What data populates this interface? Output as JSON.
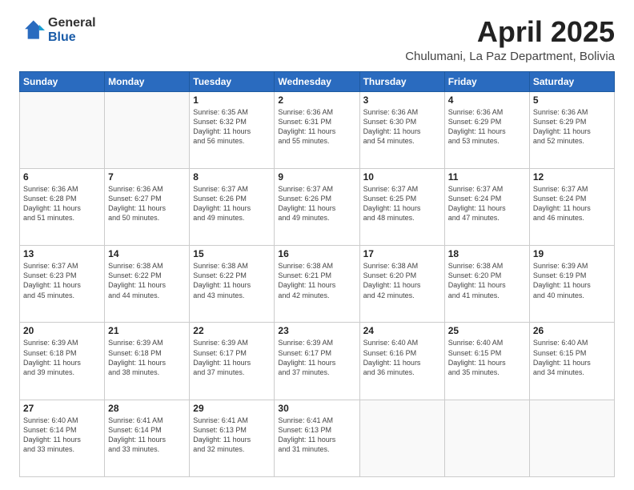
{
  "logo": {
    "general": "General",
    "blue": "Blue"
  },
  "title": "April 2025",
  "location": "Chulumani, La Paz Department, Bolivia",
  "days_header": [
    "Sunday",
    "Monday",
    "Tuesday",
    "Wednesday",
    "Thursday",
    "Friday",
    "Saturday"
  ],
  "weeks": [
    [
      {
        "day": "",
        "info": ""
      },
      {
        "day": "",
        "info": ""
      },
      {
        "day": "1",
        "info": "Sunrise: 6:35 AM\nSunset: 6:32 PM\nDaylight: 11 hours\nand 56 minutes."
      },
      {
        "day": "2",
        "info": "Sunrise: 6:36 AM\nSunset: 6:31 PM\nDaylight: 11 hours\nand 55 minutes."
      },
      {
        "day": "3",
        "info": "Sunrise: 6:36 AM\nSunset: 6:30 PM\nDaylight: 11 hours\nand 54 minutes."
      },
      {
        "day": "4",
        "info": "Sunrise: 6:36 AM\nSunset: 6:29 PM\nDaylight: 11 hours\nand 53 minutes."
      },
      {
        "day": "5",
        "info": "Sunrise: 6:36 AM\nSunset: 6:29 PM\nDaylight: 11 hours\nand 52 minutes."
      }
    ],
    [
      {
        "day": "6",
        "info": "Sunrise: 6:36 AM\nSunset: 6:28 PM\nDaylight: 11 hours\nand 51 minutes."
      },
      {
        "day": "7",
        "info": "Sunrise: 6:36 AM\nSunset: 6:27 PM\nDaylight: 11 hours\nand 50 minutes."
      },
      {
        "day": "8",
        "info": "Sunrise: 6:37 AM\nSunset: 6:26 PM\nDaylight: 11 hours\nand 49 minutes."
      },
      {
        "day": "9",
        "info": "Sunrise: 6:37 AM\nSunset: 6:26 PM\nDaylight: 11 hours\nand 49 minutes."
      },
      {
        "day": "10",
        "info": "Sunrise: 6:37 AM\nSunset: 6:25 PM\nDaylight: 11 hours\nand 48 minutes."
      },
      {
        "day": "11",
        "info": "Sunrise: 6:37 AM\nSunset: 6:24 PM\nDaylight: 11 hours\nand 47 minutes."
      },
      {
        "day": "12",
        "info": "Sunrise: 6:37 AM\nSunset: 6:24 PM\nDaylight: 11 hours\nand 46 minutes."
      }
    ],
    [
      {
        "day": "13",
        "info": "Sunrise: 6:37 AM\nSunset: 6:23 PM\nDaylight: 11 hours\nand 45 minutes."
      },
      {
        "day": "14",
        "info": "Sunrise: 6:38 AM\nSunset: 6:22 PM\nDaylight: 11 hours\nand 44 minutes."
      },
      {
        "day": "15",
        "info": "Sunrise: 6:38 AM\nSunset: 6:22 PM\nDaylight: 11 hours\nand 43 minutes."
      },
      {
        "day": "16",
        "info": "Sunrise: 6:38 AM\nSunset: 6:21 PM\nDaylight: 11 hours\nand 42 minutes."
      },
      {
        "day": "17",
        "info": "Sunrise: 6:38 AM\nSunset: 6:20 PM\nDaylight: 11 hours\nand 42 minutes."
      },
      {
        "day": "18",
        "info": "Sunrise: 6:38 AM\nSunset: 6:20 PM\nDaylight: 11 hours\nand 41 minutes."
      },
      {
        "day": "19",
        "info": "Sunrise: 6:39 AM\nSunset: 6:19 PM\nDaylight: 11 hours\nand 40 minutes."
      }
    ],
    [
      {
        "day": "20",
        "info": "Sunrise: 6:39 AM\nSunset: 6:18 PM\nDaylight: 11 hours\nand 39 minutes."
      },
      {
        "day": "21",
        "info": "Sunrise: 6:39 AM\nSunset: 6:18 PM\nDaylight: 11 hours\nand 38 minutes."
      },
      {
        "day": "22",
        "info": "Sunrise: 6:39 AM\nSunset: 6:17 PM\nDaylight: 11 hours\nand 37 minutes."
      },
      {
        "day": "23",
        "info": "Sunrise: 6:39 AM\nSunset: 6:17 PM\nDaylight: 11 hours\nand 37 minutes."
      },
      {
        "day": "24",
        "info": "Sunrise: 6:40 AM\nSunset: 6:16 PM\nDaylight: 11 hours\nand 36 minutes."
      },
      {
        "day": "25",
        "info": "Sunrise: 6:40 AM\nSunset: 6:15 PM\nDaylight: 11 hours\nand 35 minutes."
      },
      {
        "day": "26",
        "info": "Sunrise: 6:40 AM\nSunset: 6:15 PM\nDaylight: 11 hours\nand 34 minutes."
      }
    ],
    [
      {
        "day": "27",
        "info": "Sunrise: 6:40 AM\nSunset: 6:14 PM\nDaylight: 11 hours\nand 33 minutes."
      },
      {
        "day": "28",
        "info": "Sunrise: 6:41 AM\nSunset: 6:14 PM\nDaylight: 11 hours\nand 33 minutes."
      },
      {
        "day": "29",
        "info": "Sunrise: 6:41 AM\nSunset: 6:13 PM\nDaylight: 11 hours\nand 32 minutes."
      },
      {
        "day": "30",
        "info": "Sunrise: 6:41 AM\nSunset: 6:13 PM\nDaylight: 11 hours\nand 31 minutes."
      },
      {
        "day": "",
        "info": ""
      },
      {
        "day": "",
        "info": ""
      },
      {
        "day": "",
        "info": ""
      }
    ]
  ]
}
